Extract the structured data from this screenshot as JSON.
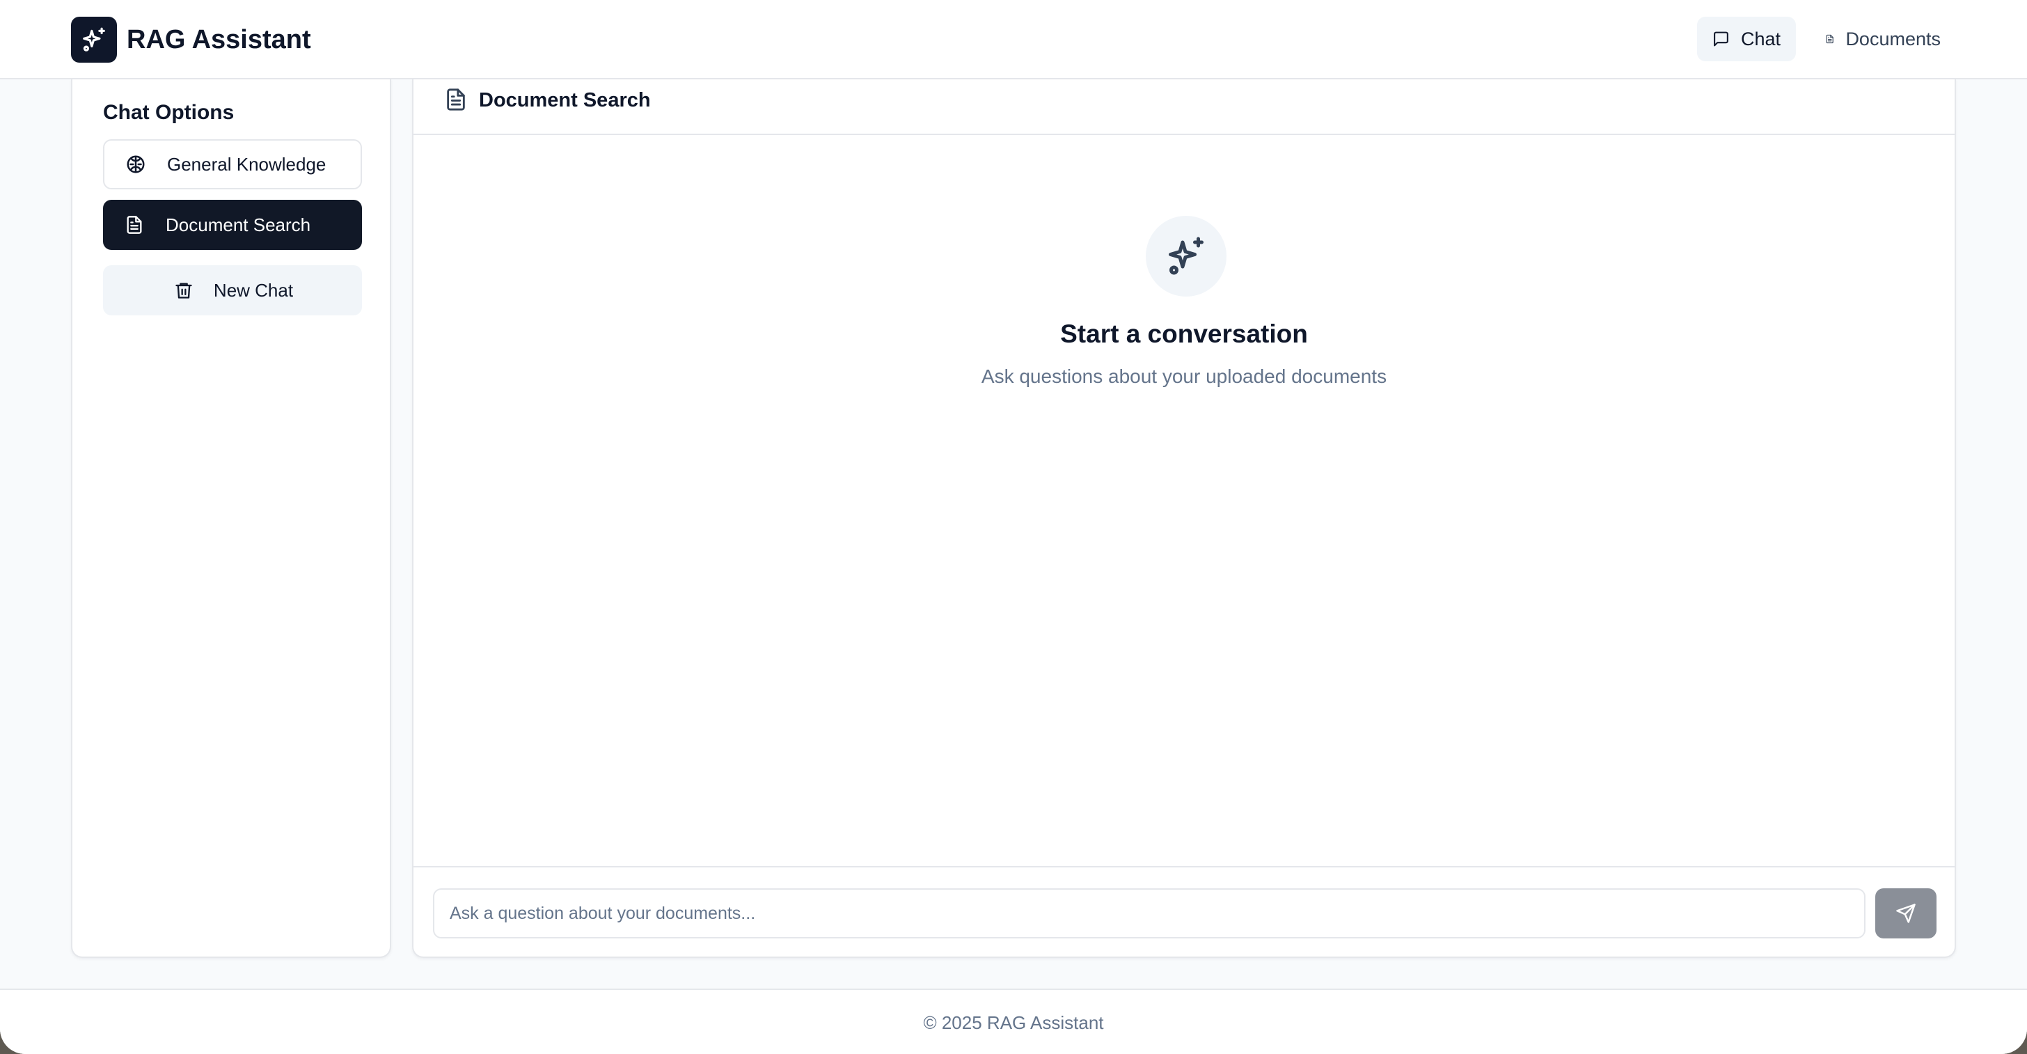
{
  "header": {
    "brand": "RAG Assistant",
    "logo_icon": "sparkles-icon",
    "nav": [
      {
        "label": "Chat",
        "icon": "message-square-icon",
        "active": true
      },
      {
        "label": "Documents",
        "icon": "file-text-icon",
        "active": false
      }
    ]
  },
  "sidebar": {
    "title": "Chat Options",
    "options": [
      {
        "label": "General Knowledge",
        "icon": "brain-icon",
        "selected": false
      },
      {
        "label": "Document Search",
        "icon": "file-text-icon",
        "selected": true
      }
    ],
    "new_chat": {
      "label": "New Chat",
      "icon": "trash-icon"
    }
  },
  "main": {
    "mode_title": "Document Search",
    "empty_state": {
      "icon": "sparkles-icon",
      "title": "Start a conversation",
      "subtitle": "Ask questions about your uploaded documents"
    },
    "input": {
      "placeholder": "Ask a question about your documents...",
      "value": ""
    },
    "send_icon": "send-icon"
  },
  "footer": {
    "text": "© 2025 RAG Assistant"
  },
  "colors": {
    "primary_dark": "#111827",
    "page_bg": "#f8fafc",
    "muted_text": "#64748b",
    "border": "#e5e7eb",
    "send_button": "#8a8f98"
  }
}
